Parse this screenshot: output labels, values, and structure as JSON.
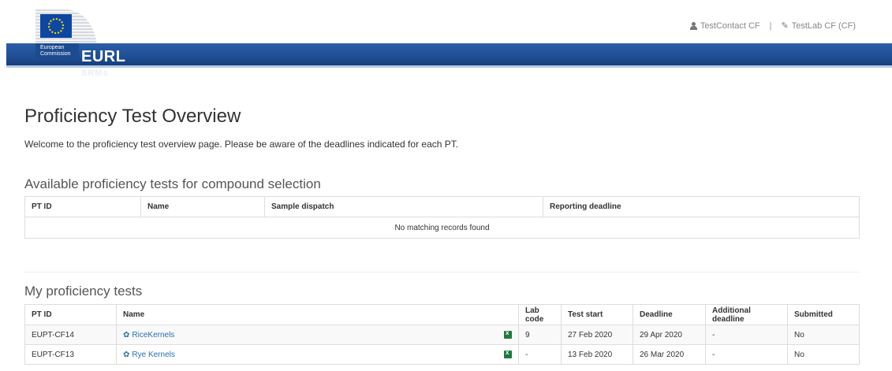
{
  "header": {
    "commission_text": "European Commission",
    "brand": "EURL",
    "brand_sub": "SRMs",
    "user_contact": "TestContact CF",
    "separator": "|",
    "user_lab": "TestLab CF (CF)"
  },
  "main": {
    "title": "Proficiency Test Overview",
    "welcome": "Welcome to the proficiency test overview page. Please be aware of the deadlines indicated for each PT."
  },
  "available": {
    "title": "Available proficiency tests for compound selection",
    "columns": [
      "PT ID",
      "Name",
      "Sample dispatch",
      "Reporting deadline"
    ],
    "empty_text": "No matching records found"
  },
  "mine": {
    "title": "My proficiency tests",
    "columns": [
      "PT ID",
      "Name",
      "Lab code",
      "Test start",
      "Deadline",
      "Additional deadline",
      "Submitted"
    ],
    "rows": [
      {
        "pt_id": "EUPT-CF14",
        "name": "RiceKernels",
        "lab_code": "9",
        "test_start": "27 Feb 2020",
        "deadline": "29 Apr 2020",
        "additional": "-",
        "submitted": "No"
      },
      {
        "pt_id": "EUPT-CF13",
        "name": "Rye Kernels",
        "lab_code": "-",
        "test_start": "13 Feb 2020",
        "deadline": "26 Mar 2020",
        "additional": "-",
        "submitted": "No"
      }
    ]
  },
  "colors": {
    "brand_blue": "#1f4f95",
    "link": "#2a6fb0",
    "excel_green": "#1f7a3e"
  },
  "icons": [
    "user-icon",
    "pencil-icon",
    "plant-icon",
    "excel-icon"
  ]
}
